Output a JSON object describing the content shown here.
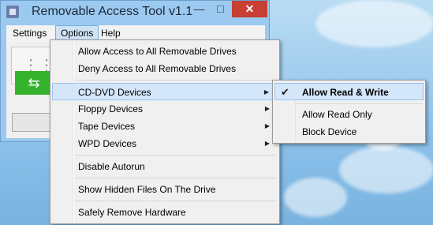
{
  "window": {
    "title": "Removable Access Tool v1.1",
    "minimize_glyph": "—",
    "maximize_glyph": "□",
    "close_glyph": "✕"
  },
  "menubar": {
    "settings": "Settings",
    "options": "Options",
    "help": "Help"
  },
  "options_menu": {
    "allow_all": "Allow Access to All Removable Drives",
    "deny_all": "Deny Access to All Removable Drives",
    "cd_dvd": "CD-DVD Devices",
    "floppy": "Floppy Devices",
    "tape": "Tape Devices",
    "wpd": "WPD Devices",
    "disable_autorun": "Disable Autorun",
    "show_hidden": "Show Hidden Files On The Drive",
    "safely_remove": "Safely Remove Hardware",
    "arrow_glyph": "▶"
  },
  "cd_dvd_submenu": {
    "allow_read_write": "Allow Read & Write",
    "allow_read_only": "Allow Read Only",
    "block_device": "Block Device",
    "check_glyph": "✔"
  },
  "icons": {
    "usb_glyph": "⇆"
  },
  "colors": {
    "accent_green": "#36b32d",
    "close_red": "#c74033",
    "highlight": "#d4e6fa"
  }
}
